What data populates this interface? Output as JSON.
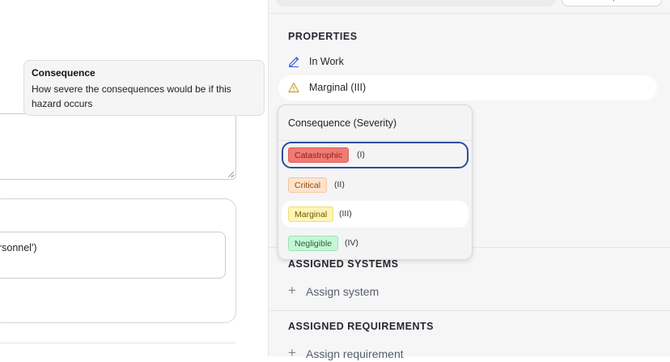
{
  "tooltip": {
    "title": "Consequence",
    "body": "How severe the consequences would be if this hazard occurs"
  },
  "left": {
    "input_value_fragment": "ersonnel')"
  },
  "properties": {
    "section_title": "PROPERTIES",
    "status_label": "In Work",
    "status_icon": "pencil-icon",
    "consequence_label": "Marginal (III)",
    "consequence_icon": "warning-triangle-icon"
  },
  "dropdown": {
    "title": "Consequence (Severity)",
    "options": [
      {
        "label": "Catastrophic",
        "roman": "(I)",
        "bg": "#f07a74",
        "fg": "#8a1f1a",
        "border": "#e25d56"
      },
      {
        "label": "Critical",
        "roman": "(II)",
        "bg": "#fde3cc",
        "fg": "#8a4b12",
        "border": "#f4c69d"
      },
      {
        "label": "Marginal",
        "roman": "(III)",
        "bg": "#fdf5b3",
        "fg": "#6e5a06",
        "border": "#eedf7a"
      },
      {
        "label": "Negligible",
        "roman": "(IV)",
        "bg": "#c8f5d8",
        "fg": "#1d6a3a",
        "border": "#9de3b6"
      }
    ]
  },
  "assigned_systems": {
    "section_title": "ASSIGNED SYSTEMS",
    "action_label": "Assign system"
  },
  "assigned_requirements": {
    "section_title": "ASSIGNED REQUIREMENTS",
    "action_label": "Assign requirement"
  },
  "colors": {
    "accent": "#2f4aa0",
    "pencil": "#3b5bdb",
    "warning": "#c9a227"
  }
}
